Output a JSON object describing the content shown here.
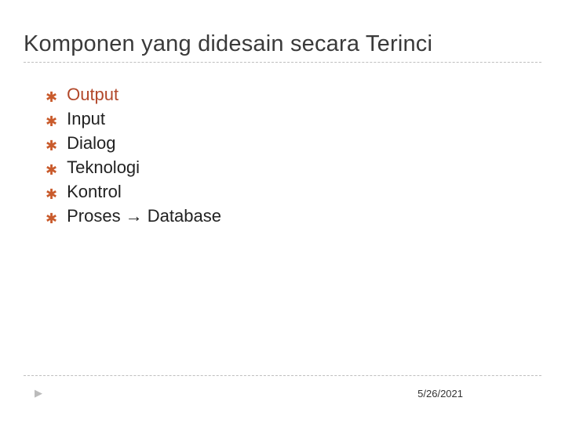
{
  "title": "Komponen yang didesain secara Terinci",
  "bullets": [
    {
      "text": "Output",
      "highlight": true
    },
    {
      "text": "Input",
      "highlight": false
    },
    {
      "text": "Dialog",
      "highlight": false
    },
    {
      "text": "Teknologi",
      "highlight": false
    },
    {
      "text": "Kontrol",
      "highlight": false
    },
    {
      "text": "Proses → Database",
      "highlight": false
    }
  ],
  "footer": {
    "date": "5/26/2021"
  }
}
